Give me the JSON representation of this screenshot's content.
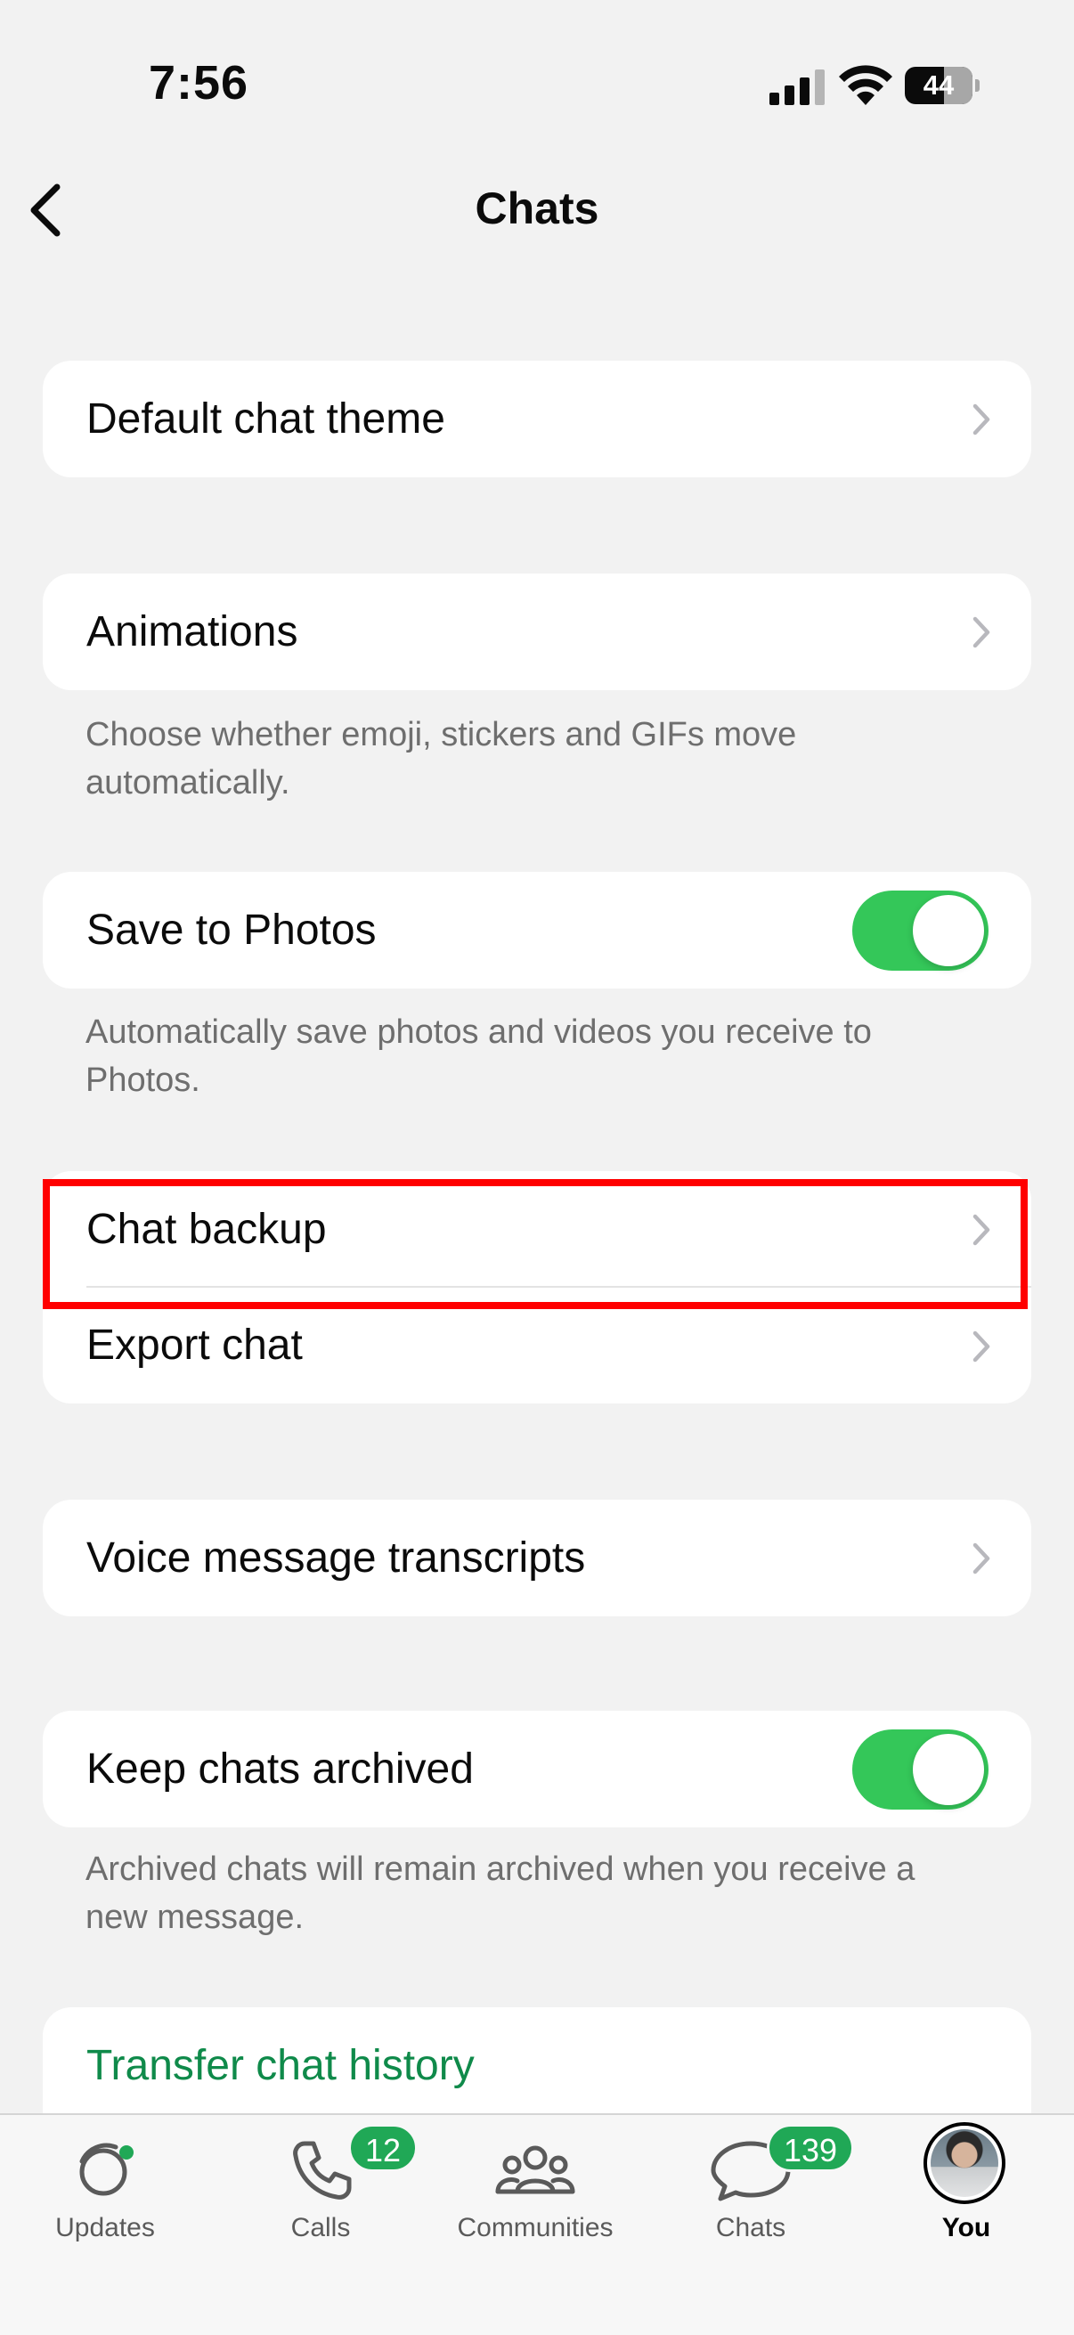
{
  "status_bar": {
    "time": "7:56",
    "battery": "44"
  },
  "nav": {
    "title": "Chats"
  },
  "sections": {
    "theme": {
      "label": "Default chat theme"
    },
    "animations": {
      "label": "Animations",
      "footnote": "Choose whether emoji, stickers and GIFs move automatically."
    },
    "save_photos": {
      "label": "Save to Photos",
      "enabled": true,
      "footnote": "Automatically save photos and videos you receive to Photos."
    },
    "chat_backup": {
      "label": "Chat backup"
    },
    "export_chat": {
      "label": "Export chat"
    },
    "voice_transcripts": {
      "label": "Voice message transcripts"
    },
    "keep_archived": {
      "label": "Keep chats archived",
      "enabled": true,
      "footnote": "Archived chats will remain archived when you receive a new message."
    },
    "transfer": {
      "label": "Transfer chat history"
    }
  },
  "tab_bar": {
    "updates": {
      "label": "Updates"
    },
    "calls": {
      "label": "Calls",
      "badge": "12"
    },
    "communities": {
      "label": "Communities"
    },
    "chats": {
      "label": "Chats",
      "badge": "139"
    },
    "you": {
      "label": "You"
    }
  },
  "colors": {
    "accent_green": "#34c759",
    "link_green": "#0f8a4a",
    "badge_green": "#20a856",
    "highlight": "#ff0000"
  },
  "icons": [
    "back-chevron-icon",
    "chevron-right-icon",
    "updates-icon",
    "phone-icon",
    "communities-icon",
    "chat-bubble-icon"
  ]
}
